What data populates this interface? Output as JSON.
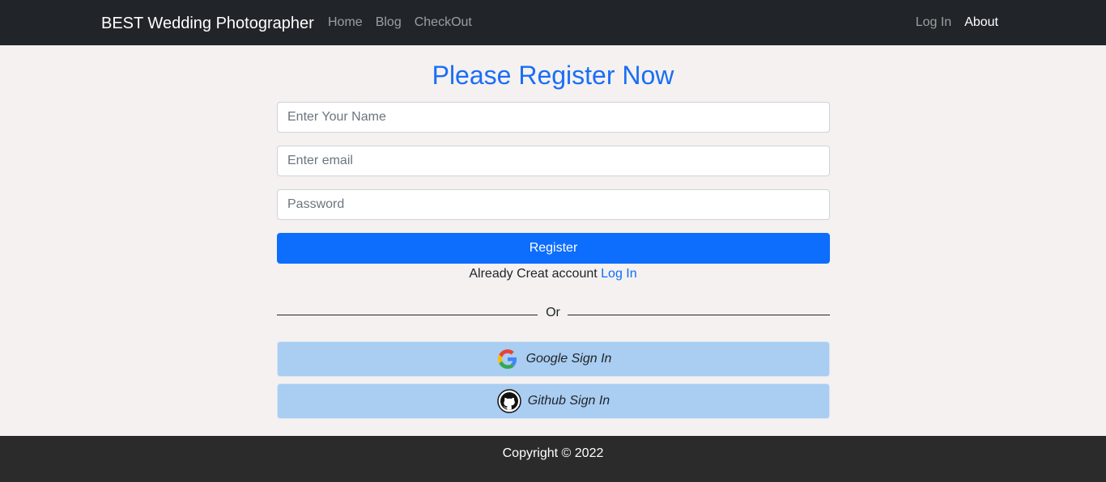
{
  "navbar": {
    "brand": "BEST Wedding Photographer",
    "left_links": [
      "Home",
      "Blog",
      "CheckOut"
    ],
    "right_links": [
      "Log In",
      "About"
    ]
  },
  "register": {
    "title": "Please Register Now",
    "name_placeholder": "Enter Your Name",
    "email_placeholder": "Enter email",
    "password_placeholder": "Password",
    "submit_label": "Register",
    "already_text": "Already Creat account",
    "login_link": "Log In",
    "divider_text": "Or"
  },
  "social": {
    "google_label": "Google Sign In",
    "github_label": "Github Sign In",
    "google_icon": "google-logo-icon",
    "github_icon": "github-logo-icon"
  },
  "footer": {
    "copyright": "Copyright © 2022"
  },
  "colors": {
    "navbar_bg": "#212529",
    "accent": "#0d6efd",
    "social_bg": "#aacdf2",
    "footer_bg": "#2b2b2b",
    "page_bg": "#f4f1f0"
  }
}
